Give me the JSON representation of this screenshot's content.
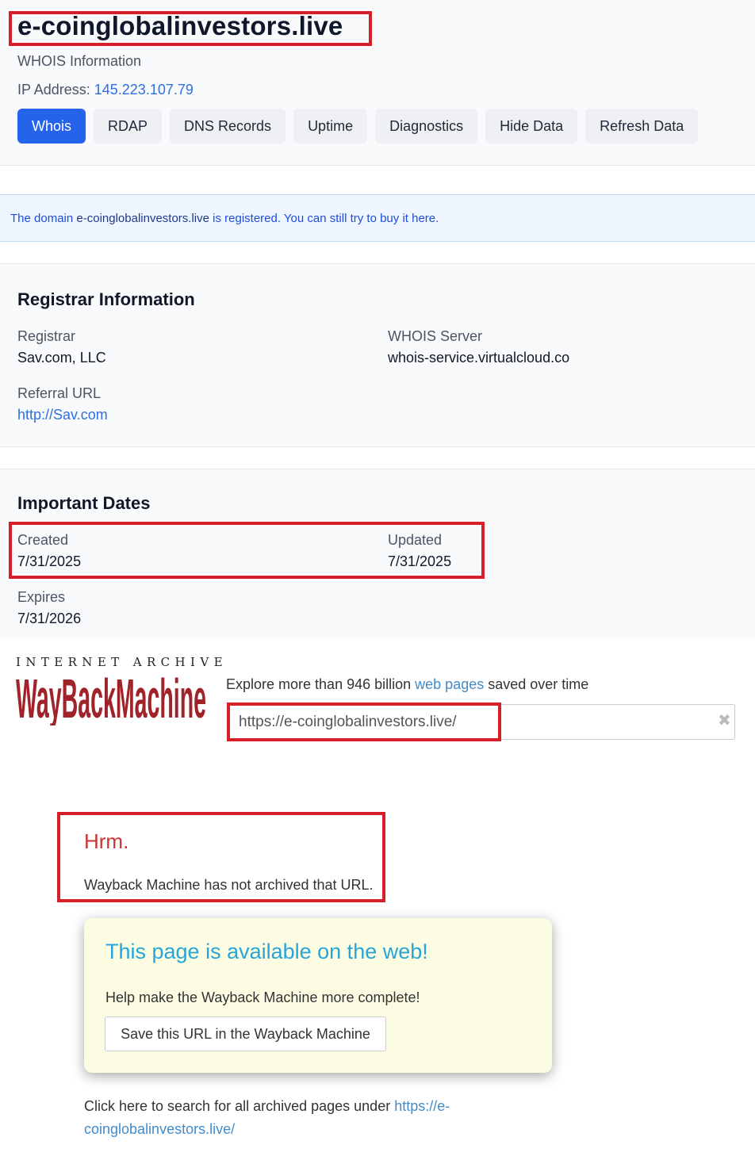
{
  "header": {
    "domain": "e-coinglobalinvestors.live",
    "subtitle": "WHOIS Information",
    "ip_label": "IP Address:",
    "ip_value": "145.223.107.79"
  },
  "tabs": [
    {
      "label": "Whois",
      "active": true
    },
    {
      "label": "RDAP"
    },
    {
      "label": "DNS Records"
    },
    {
      "label": "Uptime"
    },
    {
      "label": "Diagnostics"
    },
    {
      "label": "Hide Data"
    },
    {
      "label": "Refresh Data"
    }
  ],
  "notice": {
    "prefix": "The domain",
    "domain": "e-coinglobalinvestors.live",
    "suffix": "is registered. You can still try to buy it here."
  },
  "registrar": {
    "title": "Registrar Information",
    "registrar_label": "Registrar",
    "registrar_value": "Sav.com, LLC",
    "whois_server_label": "WHOIS Server",
    "whois_server_value": "whois-service.virtualcloud.co",
    "referral_label": "Referral URL",
    "referral_value": "http://Sav.com"
  },
  "dates": {
    "title": "Important Dates",
    "created_label": "Created",
    "created_value": "7/31/2025",
    "updated_label": "Updated",
    "updated_value": "7/31/2025",
    "expires_label": "Expires",
    "expires_value": "7/31/2026"
  },
  "wayback": {
    "ia_text": "INTERNET ARCHIVE",
    "logo_text": "WayBackMachine",
    "explore_prefix": "Explore more than 946 billion",
    "explore_link": "web pages",
    "explore_suffix": "saved over time",
    "url_value": "https://e-coinglobalinvestors.live/",
    "clear_glyph": "✖",
    "hrm_title": "Hrm.",
    "hrm_message": "Wayback Machine has not archived that URL.",
    "avail_title": "This page is available on the web!",
    "avail_help": "Help make the Wayback Machine more complete!",
    "save_button": "Save this URL in the Wayback Machine",
    "search_prefix": "Click here to search for all archived pages under",
    "search_link": "https://e-coinglobalinvestors.live/"
  },
  "colors": {
    "accent": "#2563eb",
    "highlight_box": "#d71f2a",
    "wayback_red": "#a02329",
    "link": "#428bca"
  }
}
